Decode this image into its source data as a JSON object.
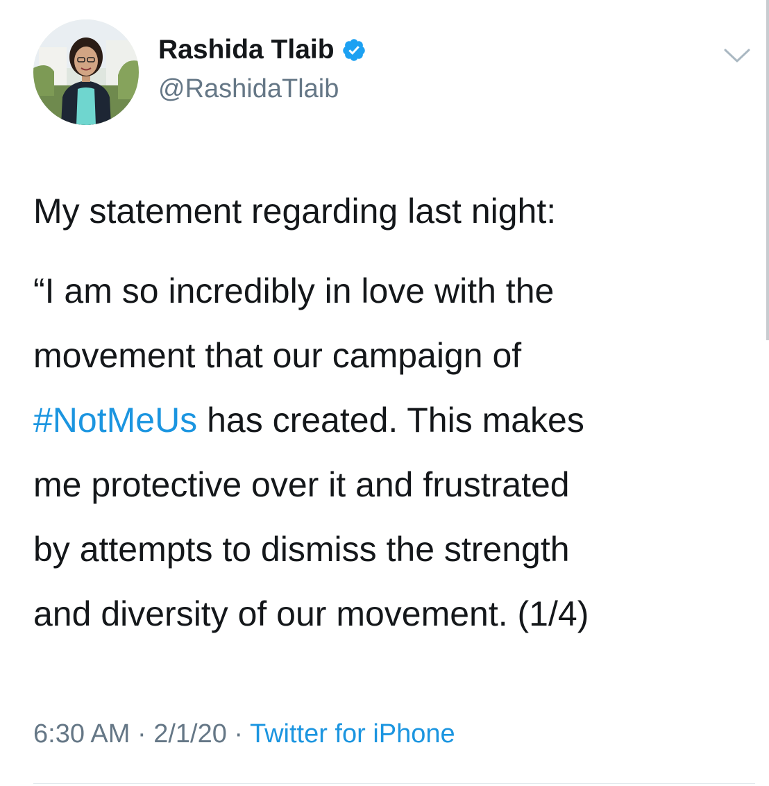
{
  "author": {
    "display_name": "Rashida Tlaib",
    "handle": "@RashidaTlaib",
    "verified": true
  },
  "tweet": {
    "intro": "My statement regarding last night:",
    "lines": [
      "“I am so incredibly in love with the",
      "movement that our campaign of",
      "has created. This makes",
      "me protective over it and frustrated",
      "by attempts to dismiss the strength",
      "and diversity of our movement. (1/4)"
    ],
    "hashtag": "#NotMeUs"
  },
  "meta": {
    "time": "6:30 AM",
    "date": "2/1/20",
    "separator": "·",
    "source": "Twitter for iPhone"
  },
  "icons": {
    "verified": "verified-badge-icon",
    "menu": "chevron-down-icon"
  },
  "colors": {
    "text": "#14171a",
    "secondary": "#657786",
    "link": "#1b95e0",
    "verified": "#1da1f2"
  }
}
